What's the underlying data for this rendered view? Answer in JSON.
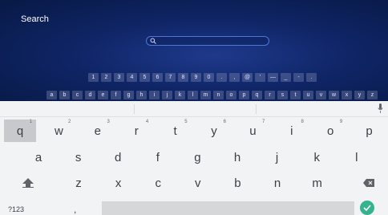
{
  "app": {
    "title": "Search",
    "search_icon": "search-icon",
    "digit_keys": [
      "1",
      "2",
      "3",
      "4",
      "5",
      "6",
      "7",
      "8",
      "9",
      "0",
      ".",
      ",",
      "@",
      "'",
      "—",
      "_",
      "-",
      "."
    ],
    "letter_keys": [
      "a",
      "b",
      "c",
      "d",
      "e",
      "f",
      "g",
      "h",
      "i",
      "j",
      "k",
      "l",
      "m",
      "n",
      "o",
      "p",
      "q",
      "r",
      "s",
      "t",
      "u",
      "v",
      "w",
      "x",
      "y",
      "z"
    ]
  },
  "keyboard": {
    "row1": [
      {
        "key": "q",
        "hint": "1"
      },
      {
        "key": "w",
        "hint": "2"
      },
      {
        "key": "e",
        "hint": "3"
      },
      {
        "key": "r",
        "hint": "4"
      },
      {
        "key": "t",
        "hint": "5"
      },
      {
        "key": "y",
        "hint": "6"
      },
      {
        "key": "u",
        "hint": "7"
      },
      {
        "key": "i",
        "hint": "8"
      },
      {
        "key": "o",
        "hint": "9"
      },
      {
        "key": "p",
        "hint": ""
      }
    ],
    "row2": [
      "a",
      "s",
      "d",
      "f",
      "g",
      "h",
      "j",
      "k",
      "l"
    ],
    "row3": [
      "z",
      "x",
      "c",
      "v",
      "b",
      "n",
      "m"
    ],
    "symbols_label": "?123",
    "comma_label": ",",
    "shift_icon": "shift-icon",
    "backspace_icon": "backspace-icon",
    "enter_icon": "check-icon",
    "mic_icon": "mic-icon",
    "accent_color": "#35b38c"
  }
}
